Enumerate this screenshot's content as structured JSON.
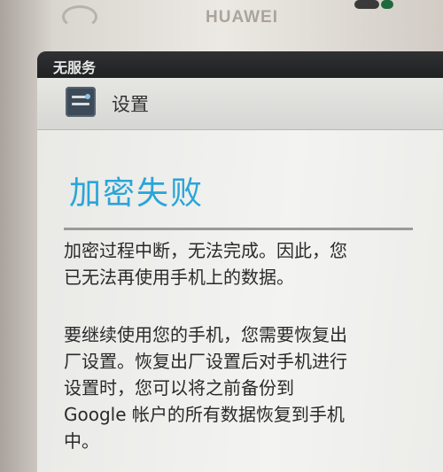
{
  "device": {
    "brand": "HUAWEI"
  },
  "status_bar": {
    "text": "无服务"
  },
  "title_bar": {
    "icon": "settings-icon",
    "title": "设置"
  },
  "main": {
    "heading": "加密失败",
    "paragraphs": [
      [
        "加密过程中断，无法完成。因此，您",
        "已无法再使用手机上的数据。"
      ],
      [
        "要继续使用您的手机，您需要恢复出",
        "厂设置。恢复出厂设置后对手机进行",
        "设置时，您可以将之前备份到",
        "Google 帐户的所有数据恢复到手机",
        "中。"
      ]
    ]
  },
  "colors": {
    "heading": "#2aa5d8",
    "status_bar": "#1f2123",
    "title_bar": "#dcdcd9"
  }
}
